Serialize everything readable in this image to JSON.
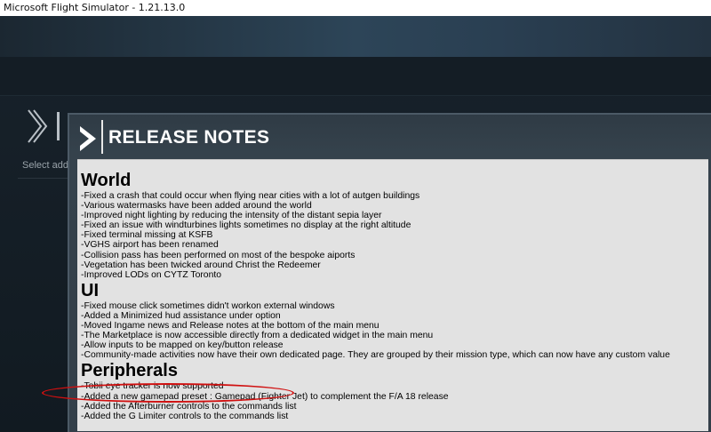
{
  "window": {
    "title": "Microsoft Flight Simulator - 1.21.13.0"
  },
  "left_panel": {
    "label": "Select add"
  },
  "release_notes": {
    "title": "RELEASE NOTES",
    "sections": [
      {
        "heading": "World",
        "items": [
          "-Fixed a crash that could occur when flying near cities with a lot of autgen buildings",
          "-Various watermasks have been added around the world",
          "-Improved night lighting by reducing the intensity of the distant sepia layer",
          "-Fixed an issue with windturbines lights sometimes no display at the right altitude",
          "-Fixed terminal missing at KSFB",
          "-VGHS airport has been renamed",
          "-Collision pass has been performed on most of the bespoke aiports",
          "-Vegetation has been twicked around Christ the Redeemer",
          "-Improved LODs on CYTZ Toronto"
        ]
      },
      {
        "heading": "UI",
        "items": [
          "-Fixed mouse click sometimes didn't workon external windows",
          "-Added a Minimized hud assistance under option",
          "-Moved Ingame news and Release notes at the bottom of the main menu",
          "-The Marketplace is now accessible directly from a dedicated widget in the main menu",
          "-Allow inputs to be mapped on key/button release",
          "-Community-made activities now have their own dedicated page. They are grouped by their mission type, which can now have any custom value"
        ]
      },
      {
        "heading": "Peripherals",
        "items": [
          "-Tobii eye tracker is now supported",
          "-Added a new gamepad preset : Gamepad (Fighter Jet) to complement the F/A 18 release",
          "-Added the Afterburner controls to the commands list",
          "-Added the G Limiter controls to the commands list"
        ]
      }
    ]
  },
  "colors": {
    "highlight": "#d01010",
    "panel": "#333f49",
    "content_bg": "#e2e2e2"
  }
}
